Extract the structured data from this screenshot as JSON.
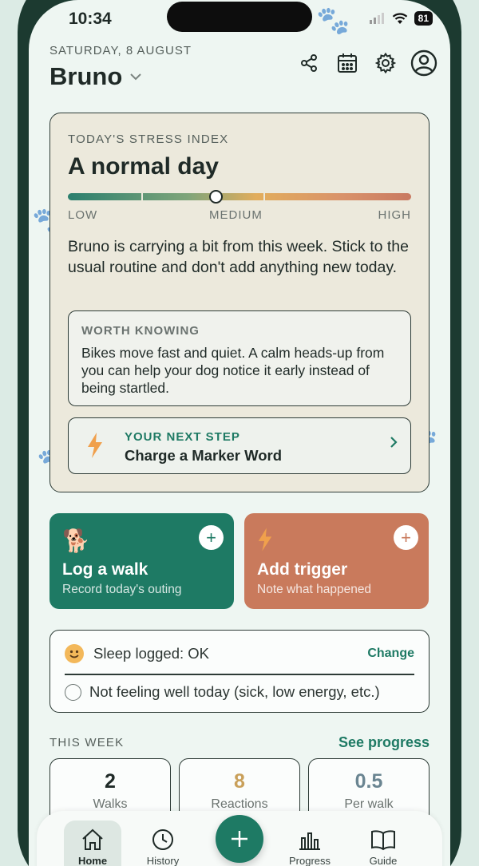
{
  "status": {
    "time": "10:34",
    "battery": "81"
  },
  "header": {
    "date": "SATURDAY, 8 AUGUST",
    "dog_name": "Bruno"
  },
  "stress": {
    "label": "TODAY'S STRESS INDEX",
    "title": "A normal day",
    "level_fraction": 0.43,
    "scale": {
      "low": "LOW",
      "medium": "MEDIUM",
      "high": "HIGH"
    },
    "description": "Bruno is carrying a bit from this week. Stick to the usual routine and don't add anything new today.",
    "worth_label": "WORTH KNOWING",
    "worth_text": "Bikes move fast and quiet. A calm heads-up from you can help your dog notice it early instead of being startled.",
    "next_label": "YOUR NEXT STEP",
    "next_title": "Charge a Marker Word"
  },
  "actions": {
    "walk": {
      "title": "Log a walk",
      "subtitle": "Record today's outing",
      "color": "#1e7a64",
      "icon": "dog-icon"
    },
    "trigger": {
      "title": "Add trigger",
      "subtitle": "Note what happened",
      "color": "#c97a5c",
      "icon": "lightning-icon"
    }
  },
  "sleep": {
    "text": "Sleep logged: OK",
    "change": "Change",
    "unwell": "Not feeling well today (sick, low energy, etc.)"
  },
  "week": {
    "label": "THIS WEEK",
    "link": "See progress",
    "stats": [
      {
        "value": "2",
        "label": "Walks",
        "color": "#1f2a27"
      },
      {
        "value": "8",
        "label": "Reactions",
        "color": "#c9a05a"
      },
      {
        "value": "0.5",
        "label": "Per walk",
        "color": "#6a8591"
      }
    ]
  },
  "tabs": {
    "home": "Home",
    "history": "History",
    "progress": "Progress",
    "guide": "Guide"
  },
  "colors": {
    "accent": "#1e7a64",
    "background": "#eef6f2"
  }
}
